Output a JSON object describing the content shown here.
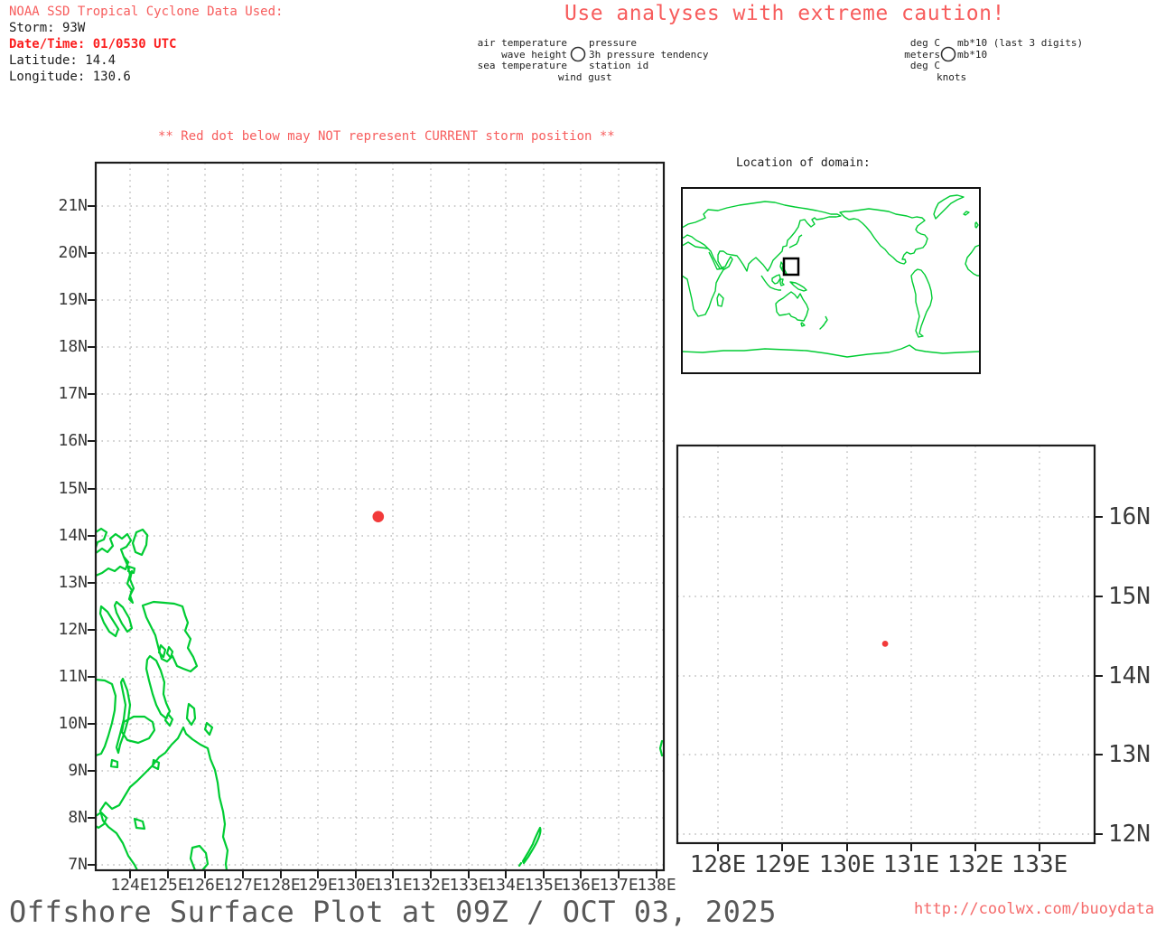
{
  "header": {
    "noaa_line": "NOAA SSD Tropical Cyclone Data Used:",
    "storm": "Storm: 93W",
    "datetime": "Date/Time: 01/0530 UTC",
    "latitude": "Latitude: 14.4",
    "longitude": "Longitude: 130.6",
    "caution": "Use analyses with extreme caution!"
  },
  "station_legend": {
    "row1_left": "air temperature",
    "row1_right": "pressure",
    "row2_left": "wave height",
    "row2_right": "3h pressure tendency",
    "row3_left": "sea temperature",
    "row3_right": "station id",
    "row4": "wind gust",
    "circle_icon": "station-circle"
  },
  "units_legend": {
    "row1_left": "deg C",
    "row1_right": "mb*10 (last 3 digits)",
    "row2_left": "meters",
    "row2_right": "mb*10",
    "row3_left": "deg C",
    "row4": "knots",
    "circle_icon": "station-circle"
  },
  "warning": "** Red dot below may NOT represent CURRENT storm position **",
  "inset": {
    "title": "Location of domain:"
  },
  "footer": {
    "title": "Offshore Surface Plot at 09Z / OCT 03, 2025",
    "url": "http://coolwx.com/buoydata"
  },
  "colors": {
    "accent_red_text": "#f75d5d",
    "bold_red_text": "#fb1f1f",
    "storm_dot": "#f23a3a",
    "coastline_green": "#00cc33",
    "grid_gray": "#9f9f9f",
    "frame_black": "#1c1c1c",
    "footer_gray": "#585858"
  },
  "chart_data": [
    {
      "type": "scatter",
      "name": "main-offshore-surface-plot-map",
      "x_tick_labels": [
        "124E",
        "125E",
        "126E",
        "127E",
        "128E",
        "129E",
        "130E",
        "131E",
        "132E",
        "133E",
        "134E",
        "135E",
        "136E",
        "137E",
        "138E"
      ],
      "y_tick_labels": [
        "21N",
        "20N",
        "19N",
        "18N",
        "17N",
        "16N",
        "15N",
        "14N",
        "13N",
        "12N",
        "11N",
        "10N",
        "9N",
        "8N",
        "7N"
      ],
      "xlim_deg_east": [
        123.1,
        138.2
      ],
      "ylim_deg_north": [
        6.9,
        21.9
      ],
      "grid": "dotted",
      "legend_position": "none",
      "coastlines": "Philippines, Palau",
      "points": [
        {
          "label": "storm-position",
          "lon": 130.6,
          "lat": 14.4,
          "color": "#f23a3a"
        }
      ]
    },
    {
      "type": "scatter",
      "name": "zoomed-domain-map",
      "x_tick_labels": [
        "128E",
        "129E",
        "130E",
        "131E",
        "132E",
        "133E"
      ],
      "y_tick_labels": [
        "16N",
        "15N",
        "14N",
        "13N",
        "12N"
      ],
      "xlim_deg_east": [
        127.4,
        133.9
      ],
      "ylim_deg_north": [
        11.9,
        16.9
      ],
      "grid": "dotted",
      "legend_position": "none",
      "points": [
        {
          "label": "storm-position",
          "lon": 130.6,
          "lat": 14.4,
          "color": "#f23a3a"
        }
      ]
    },
    {
      "type": "map",
      "name": "world-location-inset",
      "title": "Location of domain:",
      "domain_box_deg": {
        "lon": [
          123.1,
          138.2
        ],
        "lat": [
          6.9,
          21.9
        ]
      }
    }
  ]
}
